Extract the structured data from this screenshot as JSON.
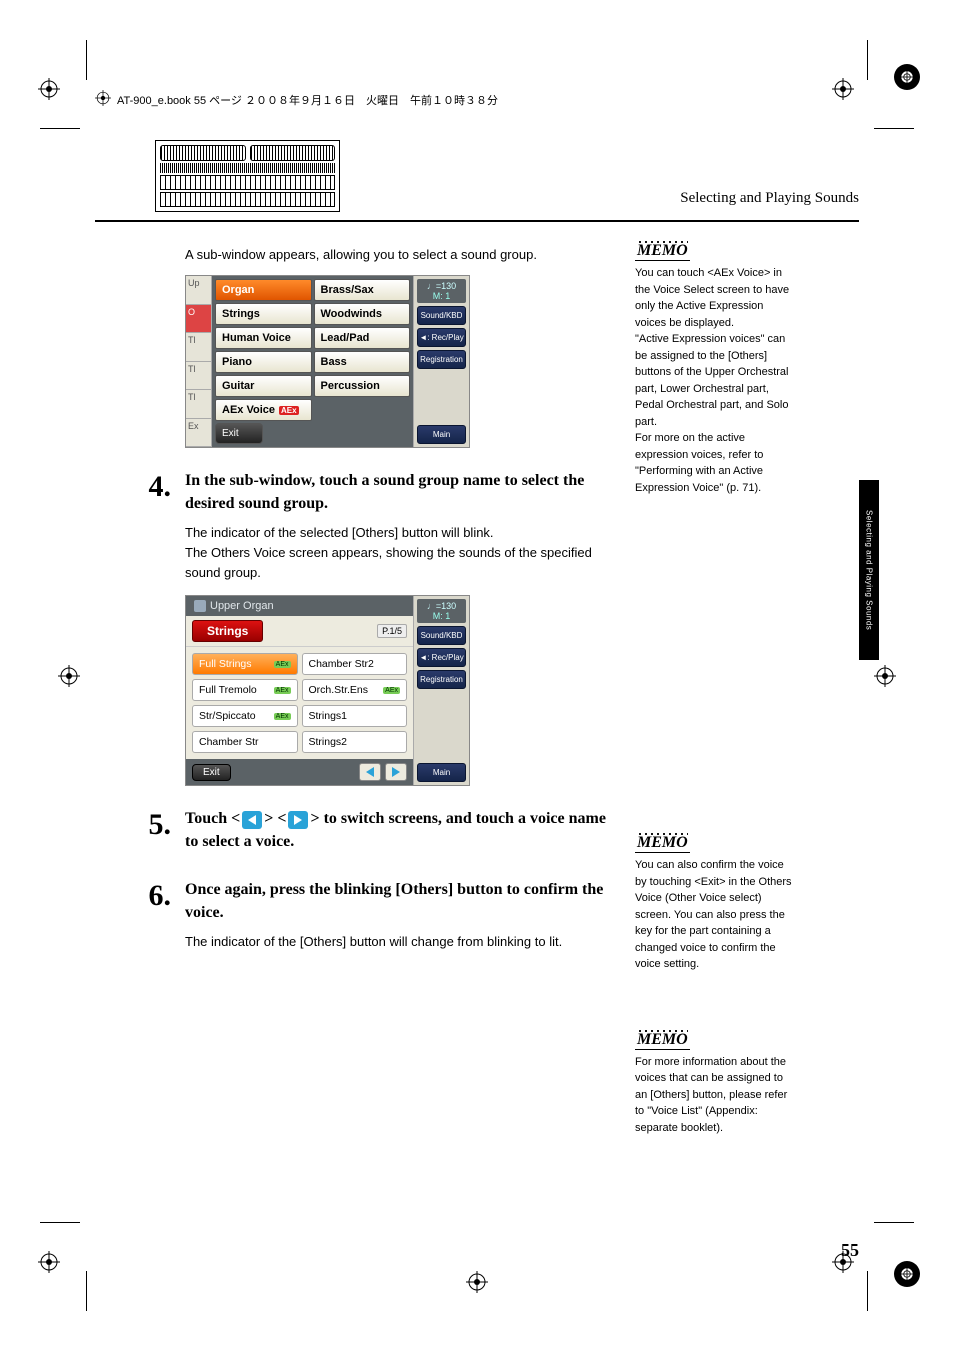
{
  "running_head": "AT-900_e.book  55 ページ  ２００８年９月１６日　火曜日　午前１０時３８分",
  "header_title": "Selecting and Playing Sounds",
  "tab_label": "Selecting and Playing Sounds",
  "page_number": "55",
  "intro_para": "A sub-window appears, allowing you to select a sound group.",
  "shot1": {
    "left_cells": [
      "Up",
      "O",
      "Tl",
      "Tl",
      "Tl",
      "Ex"
    ],
    "buttons": {
      "organ": "Organ",
      "brasssax": "Brass/Sax",
      "strings": "Strings",
      "woodwinds": "Woodwinds",
      "humanvoice": "Human Voice",
      "leadpad": "Lead/Pad",
      "piano": "Piano",
      "bass": "Bass",
      "guitar": "Guitar",
      "percussion": "Percussion",
      "aexvoice": "AEx Voice",
      "exit": "Exit"
    },
    "side": {
      "tempo_top": "♩=130",
      "tempo_bot": "M:    1",
      "soundkbd": "Sound/KBD",
      "recplay": "◄: Rec/Play",
      "registration": "Registration",
      "main": "Main"
    }
  },
  "step4": {
    "num": "4.",
    "head": "In the sub-window, touch a sound group name to select the desired sound group.",
    "p1": "The indicator of the selected [Others] button will blink.",
    "p2": "The Others Voice screen appears, showing the sounds of the specified sound group."
  },
  "shot2": {
    "title": "Upper Organ",
    "tab": "Strings",
    "page": "P.1/5",
    "voices_left": [
      {
        "name": "Full Strings",
        "aex": true,
        "sel": true
      },
      {
        "name": "Full Tremolo",
        "aex": true,
        "sel": false
      },
      {
        "name": "Str/Spiccato",
        "aex": true,
        "sel": false
      },
      {
        "name": "Chamber Str",
        "aex": false,
        "sel": false
      }
    ],
    "voices_right": [
      {
        "name": "Chamber Str2",
        "aex": false,
        "sel": false
      },
      {
        "name": "Orch.Str.Ens",
        "aex": true,
        "sel": false
      },
      {
        "name": "Strings1",
        "aex": false,
        "sel": false
      },
      {
        "name": "Strings2",
        "aex": false,
        "sel": false
      }
    ],
    "exit": "Exit",
    "side": {
      "tempo_top": "♩=130",
      "tempo_bot": "M:    1",
      "soundkbd": "Sound/KBD",
      "recplay": "◄: Rec/Play",
      "registration": "Registration",
      "main": "Main"
    }
  },
  "step5": {
    "num": "5.",
    "head_a": "Touch <",
    "head_b": "> <",
    "head_c": "> to switch screens, and touch a voice name to select a voice."
  },
  "step6": {
    "num": "6.",
    "head": "Once again, press the blinking [Others] button to confirm the voice.",
    "p1": "The indicator of the [Others] button will change from blinking to lit."
  },
  "memo1": {
    "label": "MEMO",
    "text": "You can touch <AEx Voice> in the Voice Select screen to have only the Active Expression voices be displayed.\n\"Active Expression voices\" can be assigned to the [Others] buttons of the Upper Orchestral part, Lower Orchestral part, Pedal Orchestral part, and Solo part.\nFor more on the active expression voices, refer to \"Performing with an Active Expression Voice\" (p. 71)."
  },
  "memo2": {
    "label": "MEMO",
    "text": "You can also confirm the voice by touching <Exit> in the Others Voice (Other Voice select) screen. You can also press the key for the part containing a changed voice to confirm the voice setting."
  },
  "memo3": {
    "label": "MEMO",
    "text": "For more information about the voices that can be assigned to an [Others] button, please refer to \"Voice List\" (Appendix: separate booklet)."
  }
}
